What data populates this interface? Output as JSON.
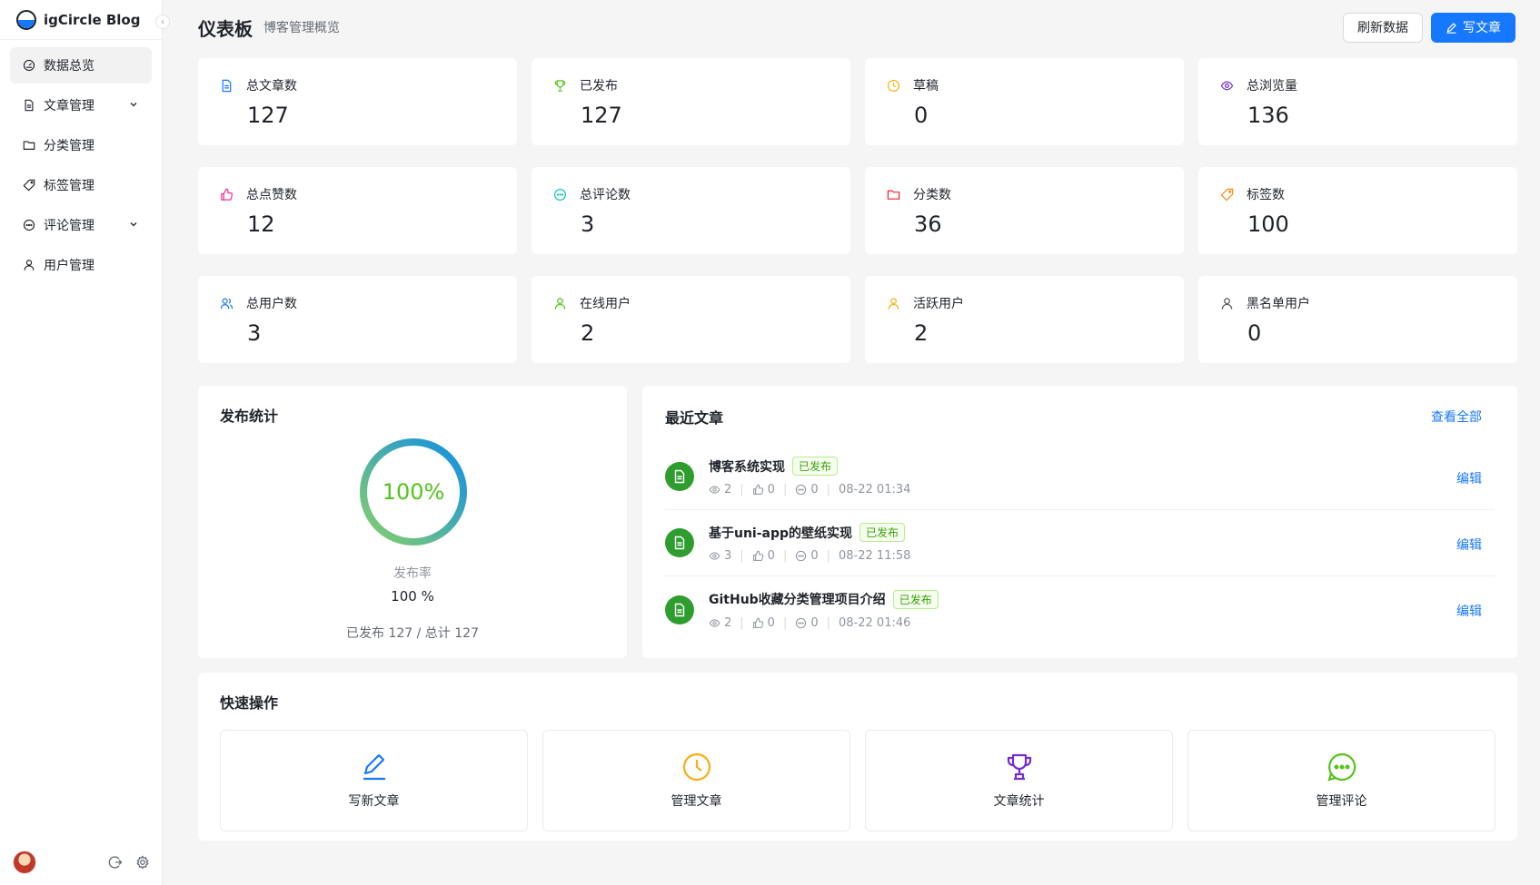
{
  "brand": {
    "name": "igCircle Blog"
  },
  "sidebar": {
    "items": [
      {
        "label": "数据总览",
        "icon": "dashboard-icon",
        "active": true
      },
      {
        "label": "文章管理",
        "icon": "document-icon",
        "has_submenu": true
      },
      {
        "label": "分类管理",
        "icon": "folder-icon"
      },
      {
        "label": "标签管理",
        "icon": "tag-icon"
      },
      {
        "label": "评论管理",
        "icon": "comment-icon",
        "has_submenu": true
      },
      {
        "label": "用户管理",
        "icon": "user-icon"
      }
    ]
  },
  "header": {
    "title": "仪表板",
    "subtitle": "博客管理概览",
    "refresh_label": "刷新数据",
    "write_label": "写文章"
  },
  "stats": [
    {
      "label": "总文章数",
      "value": "127",
      "icon": "document-icon",
      "color": "#1677ff"
    },
    {
      "label": "已发布",
      "value": "127",
      "icon": "trophy-icon",
      "color": "#52c41a"
    },
    {
      "label": "草稿",
      "value": "0",
      "icon": "clock-icon",
      "color": "#faad14"
    },
    {
      "label": "总浏览量",
      "value": "136",
      "icon": "eye-icon",
      "color": "#722ed1"
    },
    {
      "label": "总点赞数",
      "value": "12",
      "icon": "thumb-up-icon",
      "color": "#eb2f96"
    },
    {
      "label": "总评论数",
      "value": "3",
      "icon": "comment-icon",
      "color": "#13c2c2"
    },
    {
      "label": "分类数",
      "value": "36",
      "icon": "folder-icon",
      "color": "#f5222d"
    },
    {
      "label": "标签数",
      "value": "100",
      "icon": "tag-icon",
      "color": "#fa8c16"
    },
    {
      "label": "总用户数",
      "value": "3",
      "icon": "users-icon",
      "color": "#1677ff"
    },
    {
      "label": "在线用户",
      "value": "2",
      "icon": "user-icon",
      "color": "#52c41a"
    },
    {
      "label": "活跃用户",
      "value": "2",
      "icon": "user-icon",
      "color": "#faad14"
    },
    {
      "label": "黑名单用户",
      "value": "0",
      "icon": "user-icon",
      "color": "#595959"
    }
  ],
  "publish": {
    "title": "发布统计",
    "percent_text": "100%",
    "progress": 1.0,
    "rate_label": "发布率",
    "rate_value": "100 %",
    "summary": "已发布 127 / 总计 127"
  },
  "recent": {
    "title": "最近文章",
    "view_all": "查看全部",
    "edit_label": "编辑",
    "articles": [
      {
        "title": "博客系统实现",
        "status": "已发布",
        "views": "2",
        "likes": "0",
        "comments": "0",
        "date": "08-22 01:34"
      },
      {
        "title": "基于uni-app的壁纸实现",
        "status": "已发布",
        "views": "3",
        "likes": "0",
        "comments": "0",
        "date": "08-22 11:58"
      },
      {
        "title": "GitHub收藏分类管理项目介绍",
        "status": "已发布",
        "views": "2",
        "likes": "0",
        "comments": "0",
        "date": "08-22 01:46"
      }
    ]
  },
  "quick": {
    "title": "快速操作",
    "actions": [
      {
        "label": "写新文章",
        "icon": "pencil-icon",
        "color": "#1677ff"
      },
      {
        "label": "管理文章",
        "icon": "clock-icon",
        "color": "#faad14"
      },
      {
        "label": "文章统计",
        "icon": "trophy-icon",
        "color": "#722ed1"
      },
      {
        "label": "管理评论",
        "icon": "comment-icon",
        "color": "#52c41a"
      }
    ]
  }
}
